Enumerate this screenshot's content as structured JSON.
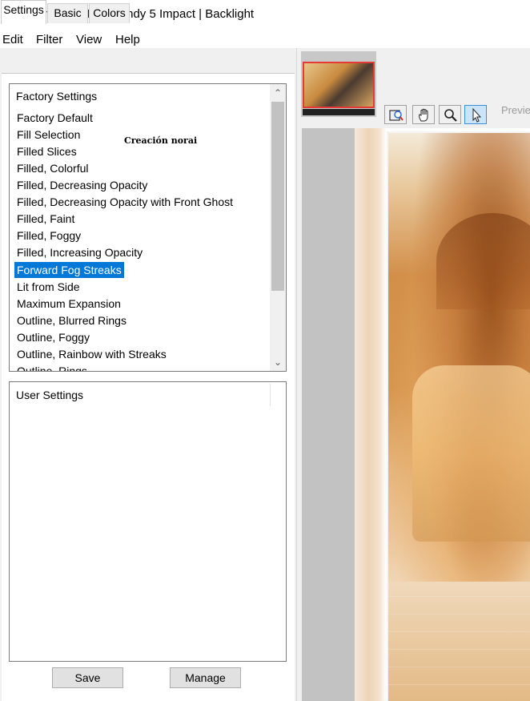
{
  "window": {
    "title": "Alien Skin | Eye Candy 5 Impact | Backlight"
  },
  "menu": {
    "items": [
      "Edit",
      "Filter",
      "View",
      "Help"
    ]
  },
  "tabs": [
    "Settings",
    "Basic",
    "Colors"
  ],
  "factory": {
    "header": "Factory Settings",
    "items": [
      "Factory Default",
      "Fill Selection",
      "Filled Slices",
      "Filled, Colorful",
      "Filled, Decreasing Opacity",
      "Filled, Decreasing Opacity with Front Ghost",
      "Filled, Faint",
      "Filled, Foggy",
      "Filled, Increasing Opacity",
      "Forward Fog Streaks",
      "Lit from Side",
      "Maximum Expansion",
      "Outline, Blurred Rings",
      "Outline, Foggy",
      "Outline, Rainbow with Streaks",
      "Outline, Rings"
    ],
    "selected": "Forward Fog Streaks",
    "watermark": "Creación norai"
  },
  "user": {
    "header": "User Settings"
  },
  "buttons": {
    "save": "Save",
    "manage": "Manage"
  },
  "toolbar": {
    "tools": [
      "zoom-fit-icon",
      "hand-icon",
      "magnifier-icon",
      "pointer-icon"
    ],
    "active_tool": "pointer-icon",
    "preview_label": "Previe"
  },
  "colors": {
    "selection": "#0078d7",
    "nav_highlight": "#e53935",
    "active_tool_bg": "#cce4f7"
  }
}
